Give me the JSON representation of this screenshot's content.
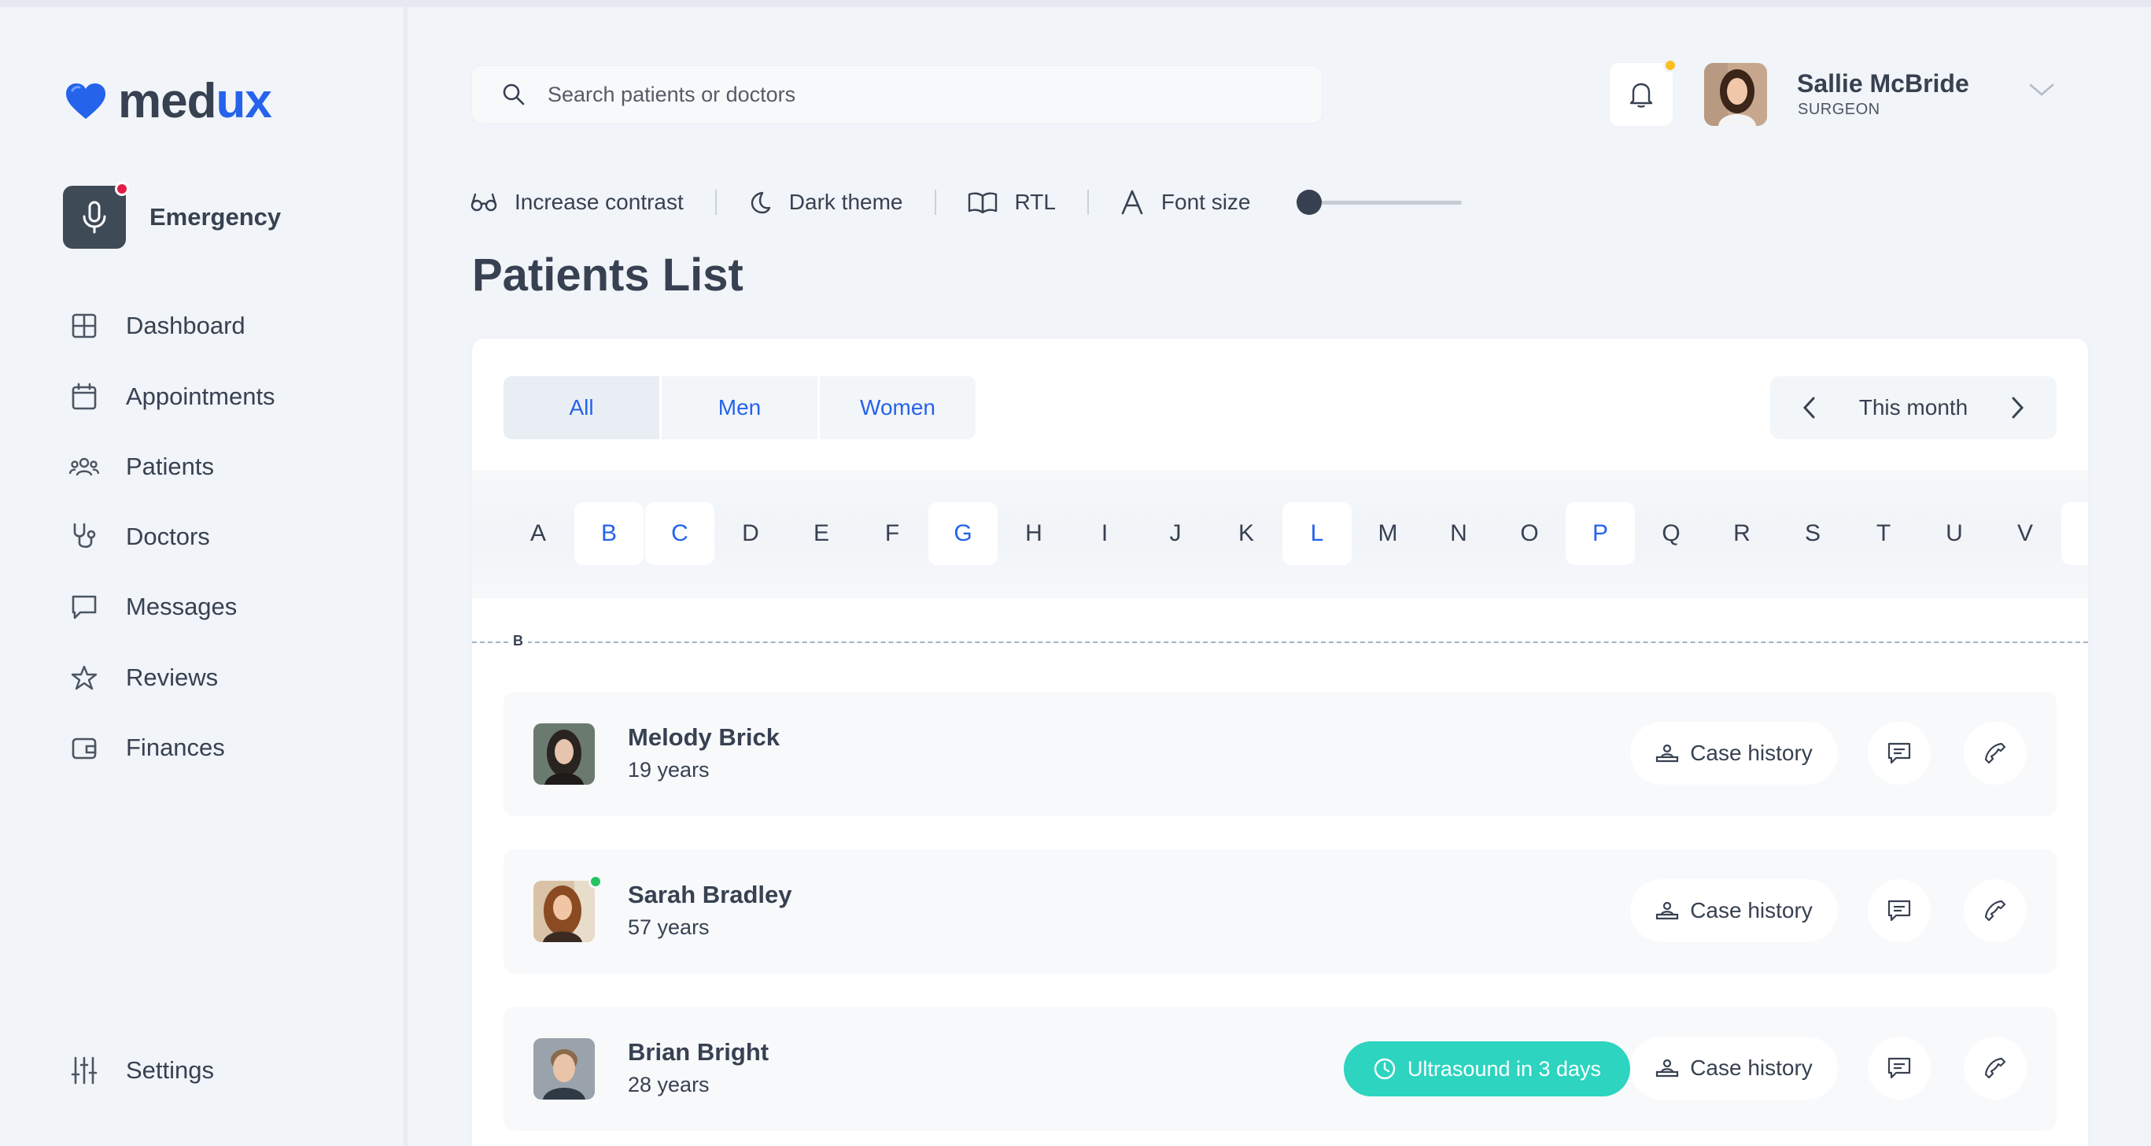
{
  "brand": {
    "part1": "med",
    "part2": "ux"
  },
  "emergency": {
    "label": "Emergency"
  },
  "nav": {
    "items": [
      {
        "label": "Dashboard",
        "icon": "dashboard-icon"
      },
      {
        "label": "Appointments",
        "icon": "calendar-icon"
      },
      {
        "label": "Patients",
        "icon": "users-icon"
      },
      {
        "label": "Doctors",
        "icon": "stethoscope-icon"
      },
      {
        "label": "Messages",
        "icon": "message-icon"
      },
      {
        "label": "Reviews",
        "icon": "star-icon"
      },
      {
        "label": "Finances",
        "icon": "wallet-icon"
      }
    ],
    "settings": "Settings"
  },
  "search": {
    "placeholder": "Search patients or doctors"
  },
  "user": {
    "name": "Sallie McBride",
    "role": "SURGEON"
  },
  "accessibility": {
    "contrast": "Increase contrast",
    "dark": "Dark theme",
    "rtl": "RTL",
    "font": "Font size",
    "font_size_level": 0
  },
  "page": {
    "title": "Patients List"
  },
  "filters": {
    "tabs": [
      "All",
      "Men",
      "Women"
    ],
    "selected_tab": "All",
    "period": "This month"
  },
  "alphabet": {
    "letters": [
      "A",
      "B",
      "C",
      "D",
      "E",
      "F",
      "G",
      "H",
      "I",
      "J",
      "K",
      "L",
      "M",
      "N",
      "O",
      "P",
      "Q",
      "R",
      "S",
      "T",
      "U",
      "V"
    ],
    "active": [
      "B",
      "C",
      "G",
      "L",
      "P"
    ]
  },
  "group_letter": "B",
  "patients": [
    {
      "name": "Melody Brick",
      "age": "19 years",
      "online": false,
      "case_label": "Case history"
    },
    {
      "name": "Sarah Bradley",
      "age": "57 years",
      "online": true,
      "case_label": "Case history"
    },
    {
      "name": "Brian Bright",
      "age": "28 years",
      "online": false,
      "case_label": "Case history",
      "badge": "Ultrasound in 3 days"
    }
  ],
  "colors": {
    "accent": "#2563eb",
    "badge": "#2dd4bf",
    "emergency_dot": "#e11d48",
    "notification_dot": "#fbbf24",
    "online": "#22c55e"
  }
}
